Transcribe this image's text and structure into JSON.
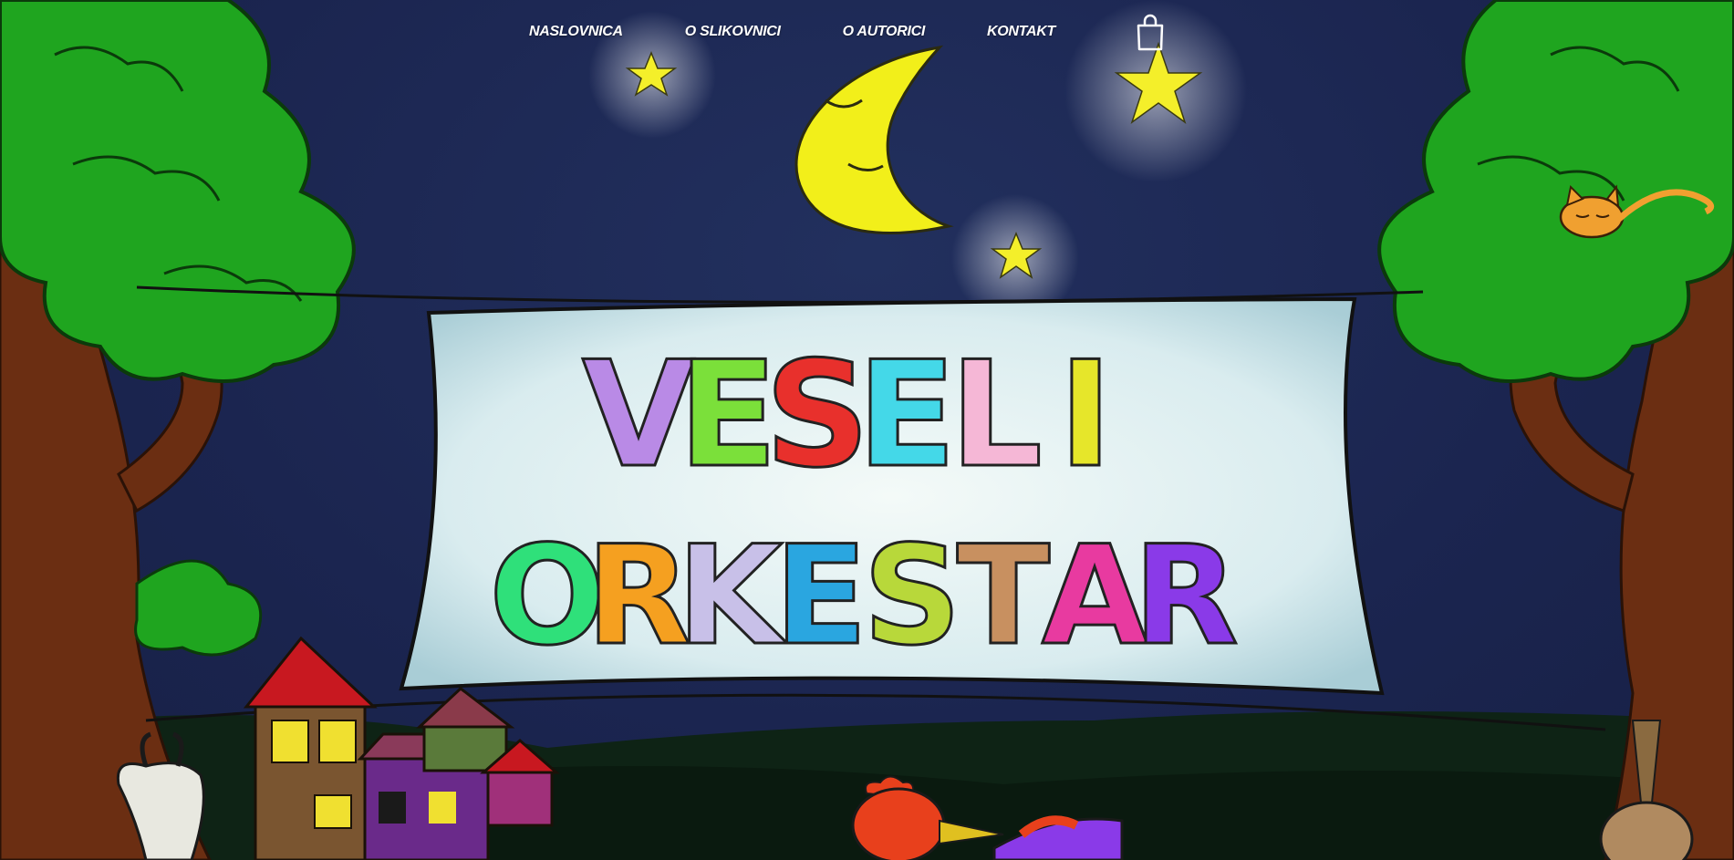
{
  "nav": {
    "items": [
      {
        "label": "NASLOVNICA"
      },
      {
        "label": "O SLIKOVNICI"
      },
      {
        "label": "O AUTORICI"
      },
      {
        "label": "KONTAKT"
      }
    ],
    "cart_icon": "shopping-bag-icon"
  },
  "banner": {
    "line1": [
      "V",
      "E",
      "S",
      "E",
      "L",
      "I"
    ],
    "line2": [
      "O",
      "R",
      "K",
      "E",
      "S",
      "T",
      "A",
      "R"
    ],
    "line1_colors": [
      "#b98ae6",
      "#7be03a",
      "#e8302c",
      "#44d8e8",
      "#f5b7d6",
      "#e6e62a"
    ],
    "line2_colors": [
      "#2fe07a",
      "#f5a020",
      "#c8c0e8",
      "#2aa6e0",
      "#b8d83a",
      "#c89060",
      "#e83aa0",
      "#8a3ae8"
    ]
  },
  "colors": {
    "sky": "#1b2550",
    "foliage": "#1fa51f",
    "trunk": "#6b2e12",
    "moon": "#f2ef1a",
    "star": "#f4ef2a",
    "ground": "#0d1f12"
  }
}
